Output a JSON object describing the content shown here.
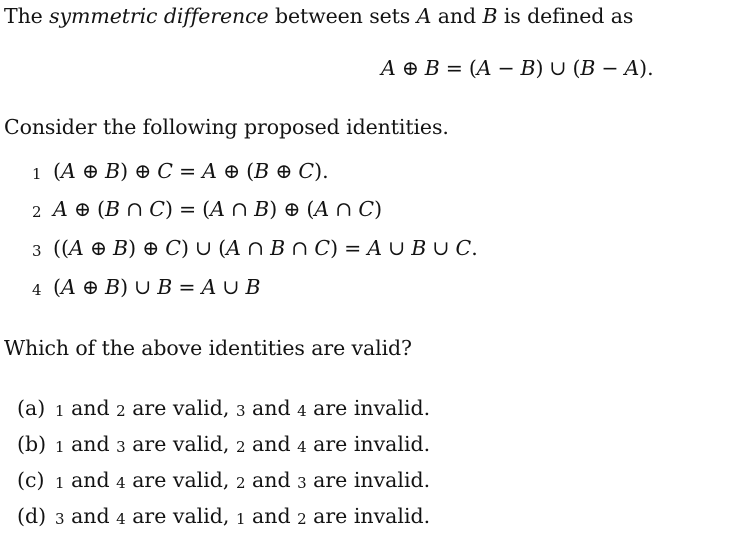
{
  "document": {
    "type": "math-question",
    "background_color": "#ffffff",
    "text_color": "#131313"
  },
  "intro": {
    "before_italic": "The ",
    "italic": "symmetric difference",
    "after_italic": " between sets ",
    "var_a": "A",
    "conjunction": " and ",
    "var_b": "B",
    "tail": " is defined as"
  },
  "display_equation": {
    "latex": "A \\oplus B = (A - B) \\cup (B - A).",
    "plain": "A ⊕ B = (A − B) ∪ (B − A).",
    "tokens": [
      "A",
      "⊕",
      "B",
      "=",
      "(",
      "A",
      "−",
      "B",
      ")",
      "∪",
      "(",
      "B",
      "−",
      "A",
      ")",
      "."
    ]
  },
  "consider_line": "Consider the following proposed identities.",
  "identities": [
    {
      "number": "1",
      "plain": "(A ⊕ B) ⊕ C = A ⊕ (B ⊕ C).",
      "latex": "(A \\oplus B) \\oplus C = A \\oplus (B \\oplus C)."
    },
    {
      "number": "2",
      "plain": "A ⊕ (B ∩ C) = (A ∩ B) ⊕ (A ∩ C)",
      "latex": "A \\oplus (B \\cap C) = (A \\cap B) \\oplus (A \\cap C)"
    },
    {
      "number": "3",
      "plain": "((A ⊕ B) ⊕ C) ∪ (A ∩ B ∩ C) = A ∪ B ∪ C.",
      "latex": "((A \\oplus B) \\oplus C) \\cup (A \\cap B \\cap C) = A \\cup B \\cup C."
    },
    {
      "number": "4",
      "plain": "(A ⊕ B) ∪ B = A ∪ B",
      "latex": "(A \\oplus B) \\cup B = A \\cup B"
    }
  ],
  "question_line": "Which of the above identities are valid?",
  "options": [
    {
      "label": "(a)",
      "text": "1 and 2 are valid, 3 and 4 are invalid.",
      "valid": [
        "1",
        "2"
      ],
      "invalid": [
        "3",
        "4"
      ]
    },
    {
      "label": "(b)",
      "text": "1 and 3 are valid, 2 and 4 are invalid.",
      "valid": [
        "1",
        "3"
      ],
      "invalid": [
        "2",
        "4"
      ]
    },
    {
      "label": "(c)",
      "text": "1 and 4 are valid, 2 and 3 are invalid.",
      "valid": [
        "1",
        "4"
      ],
      "invalid": [
        "2",
        "3"
      ]
    },
    {
      "label": "(d)",
      "text": "3 and 4 are valid, 1 and 2 are invalid.",
      "valid": [
        "3",
        "4"
      ],
      "invalid": [
        "1",
        "2"
      ]
    }
  ],
  "option_phrases": {
    "are_valid": " are valid, ",
    "and": " and ",
    "are_invalid": " are invalid."
  }
}
